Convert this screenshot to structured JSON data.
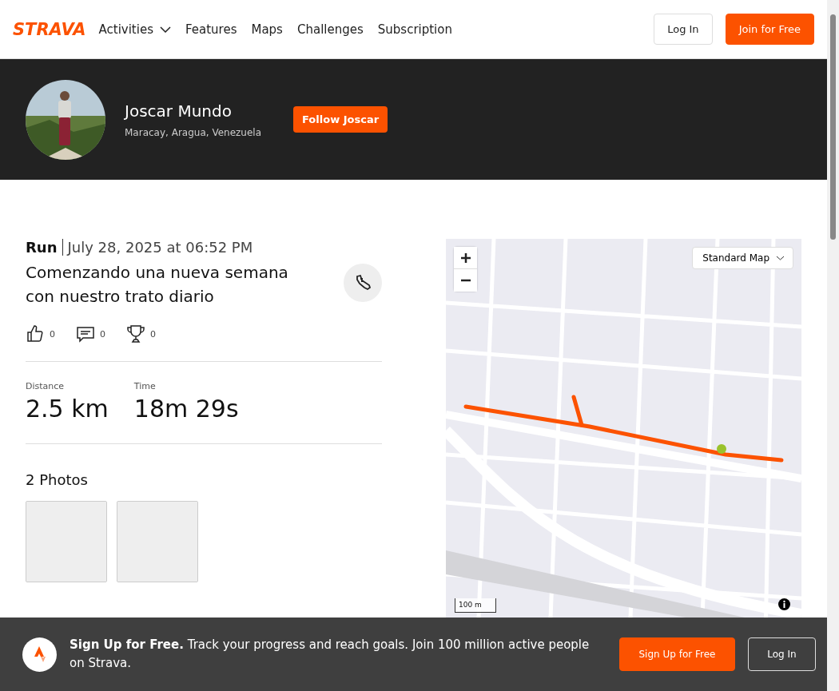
{
  "header": {
    "logo": "STRAVA",
    "nav": [
      {
        "label": "Activities",
        "dropdown": true
      },
      {
        "label": "Features",
        "dropdown": false
      },
      {
        "label": "Maps",
        "dropdown": false
      },
      {
        "label": "Challenges",
        "dropdown": false
      },
      {
        "label": "Subscription",
        "dropdown": false
      }
    ],
    "login": "Log In",
    "join": "Join for Free"
  },
  "profile": {
    "name": "Joscar Mundo",
    "location": "Maracay, Aragua, Venezuela",
    "follow": "Follow Joscar"
  },
  "activity": {
    "sport": "Run",
    "date": "July 28, 2025 at 06:52 PM",
    "title": "Comenzando una nueva semana con nuestro trato diario",
    "social": [
      {
        "kind": "kudos",
        "count": "0"
      },
      {
        "kind": "comments",
        "count": "0"
      },
      {
        "kind": "achievements",
        "count": "0"
      }
    ],
    "stats": [
      {
        "label": "Distance",
        "value": "2.5 km"
      },
      {
        "label": "Time",
        "value": "18m 29s"
      }
    ],
    "photos_title": "2 Photos"
  },
  "map": {
    "style": "Standard Map",
    "scale": "100 m"
  },
  "banner": {
    "text": "**Sign Up for Free.** Track your progress and reach goals. Join 100 million active people on Strava.",
    "signup": "Sign Up for Free",
    "login": "Log In"
  }
}
